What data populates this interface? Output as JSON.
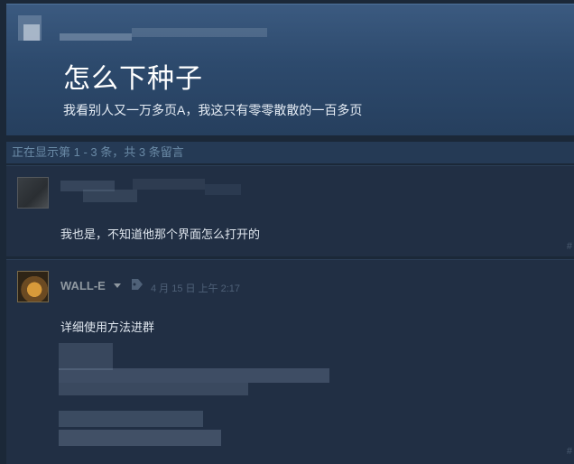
{
  "topic": {
    "title": "怎么下种子",
    "body": "我看别人又一万多页A，我这只有零零散散的一百多页"
  },
  "comment_count_text": "正在显示第 1 - 3 条，共 3 条留言",
  "comments": [
    {
      "text": "我也是，不知道他那个界面怎么打开的",
      "hash": "#"
    },
    {
      "author": "WALL-E",
      "timestamp": "4 月 15 日 上午 2:17",
      "text": "详细使用方法进群",
      "hash": "#"
    }
  ],
  "icons": {
    "dropdown": "chevron-down-icon",
    "tag": "tag-icon"
  },
  "colors": {
    "page_background": "#1b2838",
    "topic_header": "#3b5a80",
    "comment_background": "#212f44",
    "author_name": "#8f98a0",
    "timestamp": "#4f6178"
  }
}
